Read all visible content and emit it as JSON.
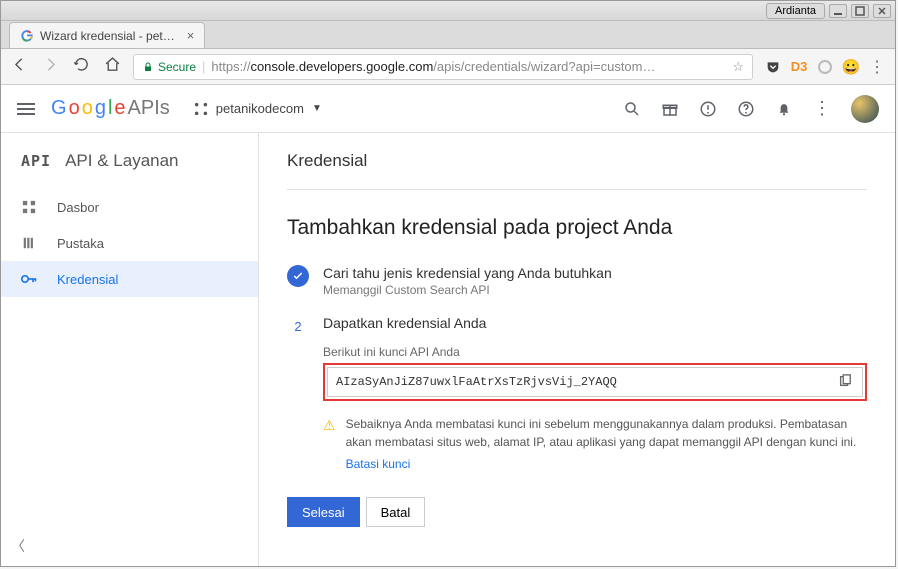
{
  "os": {
    "user": "Ardianta"
  },
  "browser": {
    "tab_title": "Wizard kredensial - pet…",
    "secure_label": "Secure",
    "url_prefix": "https://",
    "url_host": "console.developers.google.com",
    "url_path": "/apis/credentials/wizard?api=custom…"
  },
  "header": {
    "logo_g": "G",
    "logo_o1": "o",
    "logo_o2": "o",
    "logo_g2": "g",
    "logo_l": "l",
    "logo_e": "e",
    "logo_apis": " APIs",
    "project": "petanikodecom"
  },
  "sidebar": {
    "brand_mono": "API",
    "brand_title": "API & Layanan",
    "items": [
      {
        "label": "Dasbor"
      },
      {
        "label": "Pustaka"
      },
      {
        "label": "Kredensial"
      }
    ]
  },
  "page": {
    "section_title": "Kredensial",
    "heading": "Tambahkan kredensial pada project Anda",
    "step1_title": "Cari tahu jenis kredensial yang Anda butuhkan",
    "step1_sub": "Memanggil Custom Search API",
    "step2_num": "2",
    "step2_title": "Dapatkan kredensial Anda",
    "api_label": "Berikut ini kunci API Anda",
    "api_key": "AIzaSyAnJiZ87uwxlFaAtrXsTzRjvsVij_2YAQQ",
    "warning_text": "Sebaiknya Anda membatasi kunci ini sebelum menggunakannya dalam produksi. Pembatasan akan membatasi situs web, alamat IP, atau aplikasi yang dapat memanggil API dengan kunci ini.",
    "restrict_link": "Batasi kunci",
    "done_btn": "Selesai",
    "cancel_btn": "Batal"
  }
}
